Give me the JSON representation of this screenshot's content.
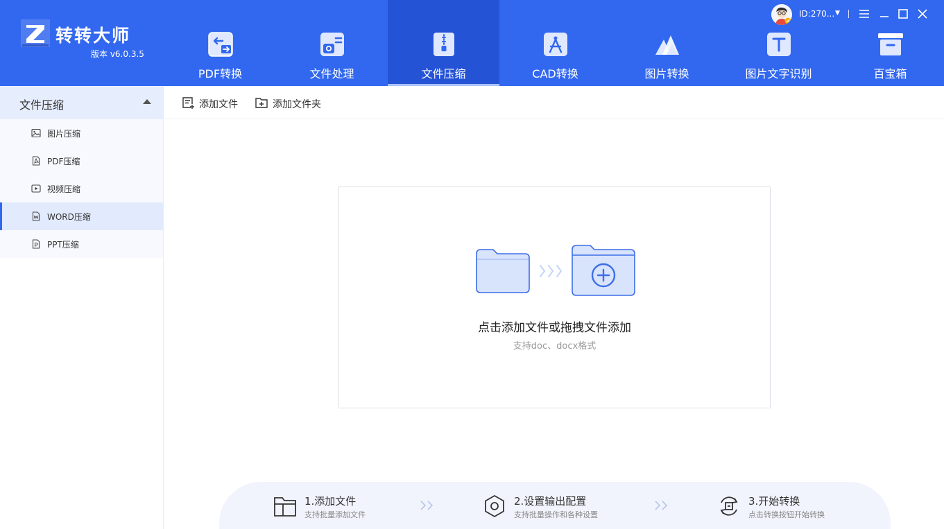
{
  "app": {
    "brand": "转转大师",
    "version": "版本 v6.0.3.5",
    "accent": "#3268ef"
  },
  "topnav": [
    {
      "label": "PDF转换",
      "icon": "pdf-convert-icon",
      "active": false
    },
    {
      "label": "文件处理",
      "icon": "file-process-icon",
      "active": false
    },
    {
      "label": "文件压缩",
      "icon": "file-compress-icon",
      "active": true
    },
    {
      "label": "CAD转换",
      "icon": "cad-convert-icon",
      "active": false
    },
    {
      "label": "图片转换",
      "icon": "image-convert-icon",
      "active": false
    },
    {
      "label": "图片文字识别",
      "icon": "ocr-icon",
      "active": false
    },
    {
      "label": "百宝箱",
      "icon": "toolbox-icon",
      "active": false
    }
  ],
  "account": {
    "user_id": "ID:270..."
  },
  "sidebar": {
    "group_title": "文件压缩",
    "items": [
      {
        "label": "图片压缩",
        "icon": "image-icon",
        "active": false
      },
      {
        "label": "PDF压缩",
        "icon": "pdf-file-icon",
        "active": false
      },
      {
        "label": "视频压缩",
        "icon": "video-icon",
        "active": false
      },
      {
        "label": "WORD压缩",
        "icon": "word-file-icon",
        "active": true
      },
      {
        "label": "PPT压缩",
        "icon": "ppt-file-icon",
        "active": false
      }
    ]
  },
  "toolbar": {
    "add_file": "添加文件",
    "add_folder": "添加文件夹"
  },
  "dropzone": {
    "main_text": "点击添加文件或拖拽文件添加",
    "sub_text": "支持doc、docx格式"
  },
  "steps": [
    {
      "title": "1.添加文件",
      "desc": "支持批量添加文件",
      "icon": "folder-icon"
    },
    {
      "title": "2.设置输出配置",
      "desc": "支持批量操作和各种设置",
      "icon": "settings-icon"
    },
    {
      "title": "3.开始转换",
      "desc": "点击转换按钮开始转换",
      "icon": "convert-icon"
    }
  ]
}
